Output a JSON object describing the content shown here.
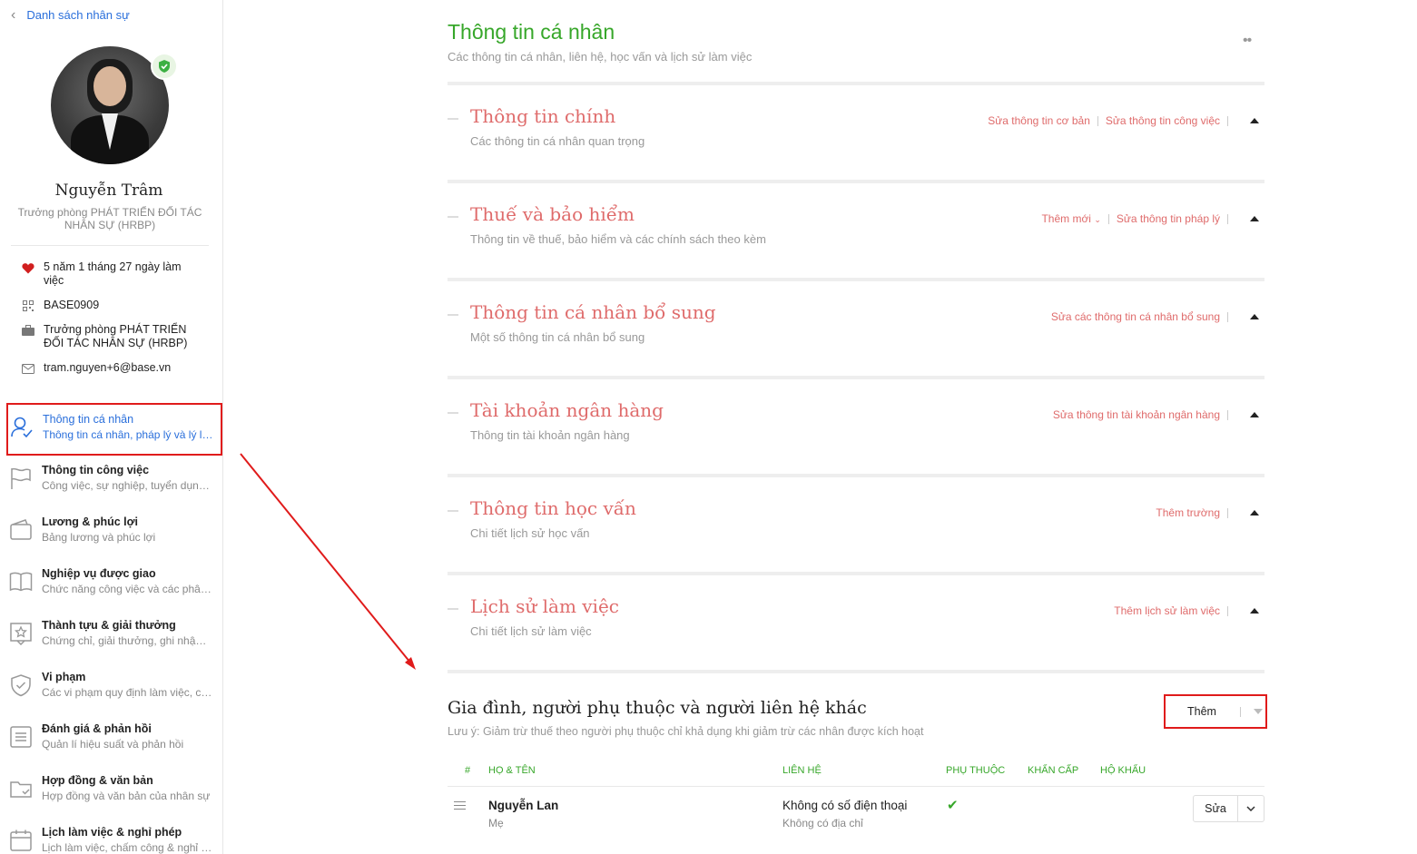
{
  "sidebar": {
    "back_label": "Danh sách nhân sự",
    "profile": {
      "name": "Nguyễn Trâm",
      "role": "Trưởng phòng PHÁT TRIỂN ĐỐI TÁC NHÂN SỰ (HRBP)"
    },
    "info": [
      {
        "icon": "heart-icon",
        "text": "5 năm 1 tháng 27 ngày làm việc"
      },
      {
        "icon": "qr-code-icon",
        "text": "BASE0909"
      },
      {
        "icon": "briefcase-icon",
        "text": "Trưởng phòng PHÁT TRIỂN ĐỐI TÁC NHÂN SỰ (HRBP)"
      },
      {
        "icon": "mail-icon",
        "text": "tram.nguyen+6@base.vn"
      }
    ],
    "nav": [
      {
        "icon": "user-check-icon",
        "title": "Thông tin cá nhân",
        "subtitle": "Thông tin cá nhân, pháp lý và lý lịch",
        "active": true
      },
      {
        "icon": "flag-icon",
        "title": "Thông tin công việc",
        "subtitle": "Công việc, sự nghiệp, tuyển dụng ..."
      },
      {
        "icon": "wallet-icon",
        "title": "Lương & phúc lợi",
        "subtitle": "Bảng lương và phúc lợi"
      },
      {
        "icon": "book-icon",
        "title": "Nghiệp vụ được giao",
        "subtitle": "Chức năng công việc và các phân..."
      },
      {
        "icon": "star-award-icon",
        "title": "Thành tựu & giải thưởng",
        "subtitle": "Chứng chỉ, giải thưởng, ghi nhận v..."
      },
      {
        "icon": "shield-icon",
        "title": "Vi phạm",
        "subtitle": "Các vi phạm quy định làm việc, ch..."
      },
      {
        "icon": "list-doc-icon",
        "title": "Đánh giá & phản hồi",
        "subtitle": "Quản lí hiệu suất và phản hồi"
      },
      {
        "icon": "folder-check-icon",
        "title": "Hợp đồng & văn bản",
        "subtitle": "Hợp đồng và văn bản của nhân sự"
      },
      {
        "icon": "calendar-icon",
        "title": "Lịch làm việc & nghỉ phép",
        "subtitle": "Lịch làm việc, chấm công & nghỉ p..."
      }
    ]
  },
  "main": {
    "title": "Thông tin cá nhân",
    "subtitle": "Các thông tin cá nhân, liên hệ, học vấn và lịch sử làm việc",
    "sections": [
      {
        "title": "Thông tin chính",
        "subtitle": "Các thông tin cá nhân quan trọng",
        "actions": [
          "Sửa thông tin cơ bản",
          "Sửa thông tin công việc"
        ]
      },
      {
        "title": "Thuế và bảo hiểm",
        "subtitle": "Thông tin về thuế, bảo hiểm và các chính sách theo kèm",
        "actions": [
          "Thêm mới",
          "Sửa thông tin pháp lý"
        ]
      },
      {
        "title": "Thông tin cá nhân bổ sung",
        "subtitle": "Một số thông tin cá nhân bổ sung",
        "actions": [
          "Sửa các thông tin cá nhân bổ sung"
        ]
      },
      {
        "title": "Tài khoản ngân hàng",
        "subtitle": "Thông tin tài khoản ngân hàng",
        "actions": [
          "Sửa thông tin tài khoản ngân hàng"
        ]
      },
      {
        "title": "Thông tin học vấn",
        "subtitle": "Chi tiết lịch sử học vấn",
        "actions": [
          "Thêm trường"
        ]
      },
      {
        "title": "Lịch sử làm việc",
        "subtitle": "Chi tiết lịch sử làm việc",
        "actions": [
          "Thêm lịch sử làm việc"
        ]
      }
    ],
    "family": {
      "title": "Gia đình, người phụ thuộc và người liên hệ khác",
      "note": "Lưu ý: Giảm trừ thuế theo người phụ thuộc chỉ khả dụng khi giảm trừ các nhân được kích hoạt",
      "add_label": "Thêm",
      "columns": [
        "#",
        "HỌ & TÊN",
        "LIÊN HỆ",
        "PHỤ THUỘC",
        "KHẨN CẤP",
        "HỘ KHẨU"
      ],
      "rows": [
        {
          "name": "Nguyễn Lan",
          "relation": "Mẹ",
          "phone": "Không có số điện thoại",
          "address": "Không có địa chỉ",
          "dependent": true,
          "edit_label": "Sửa"
        }
      ]
    }
  },
  "colors": {
    "accent_green": "#37a72a",
    "section_red": "#df6b6b",
    "link_blue": "#2a6fdb",
    "highlight_red": "#e01b1b"
  }
}
